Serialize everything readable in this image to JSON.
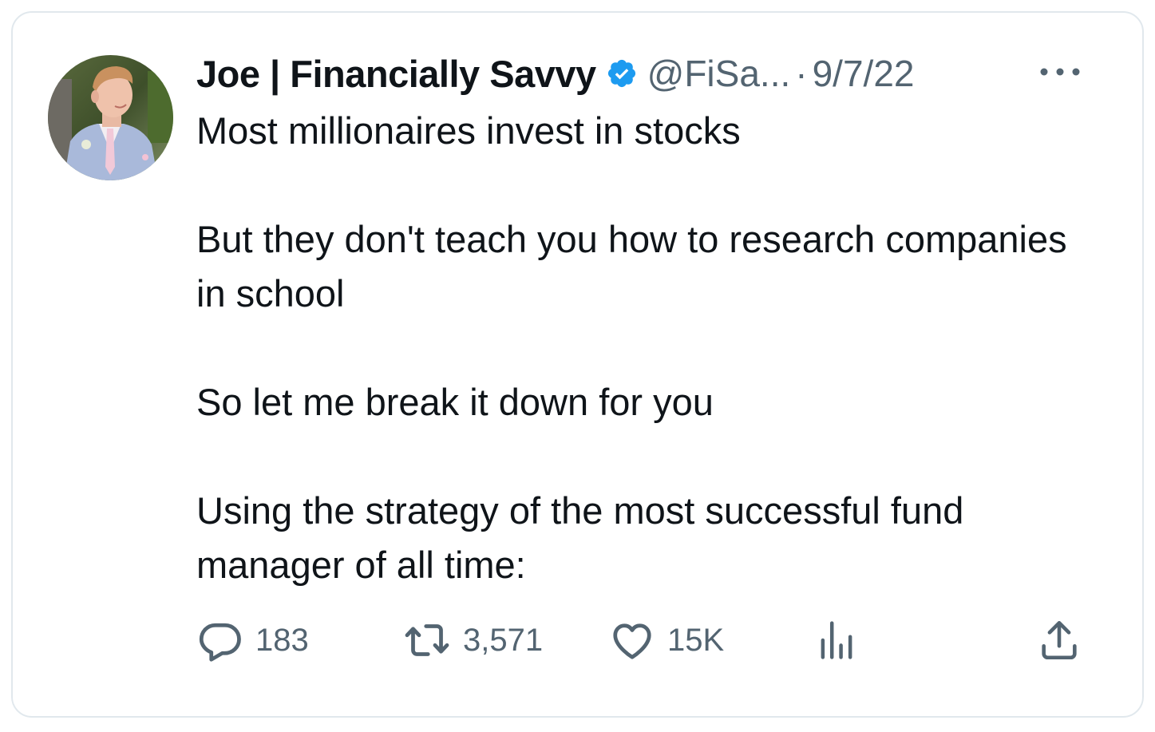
{
  "tweet": {
    "author": {
      "display_name": "Joe | Financially Savvy",
      "handle": "@FiSa...",
      "verified": true
    },
    "separator": "·",
    "date": "9/7/22",
    "paragraphs": [
      "Most millionaires invest in stocks",
      "But they don't teach you how to research companies in school",
      "So let me break it down for you",
      "Using the strategy of the most successful fund manager of all time:"
    ],
    "actions": {
      "reply_count": "183",
      "retweet_count": "3,571",
      "like_count": "15K"
    }
  },
  "colors": {
    "verified_blue": "#1d9bf0",
    "text_primary": "#0f1419",
    "text_secondary": "#536471",
    "border": "#e1e8ed"
  },
  "icons": [
    "verified-badge-icon",
    "more-options-icon",
    "reply-icon",
    "retweet-icon",
    "like-icon",
    "analytics-icon",
    "share-icon"
  ]
}
